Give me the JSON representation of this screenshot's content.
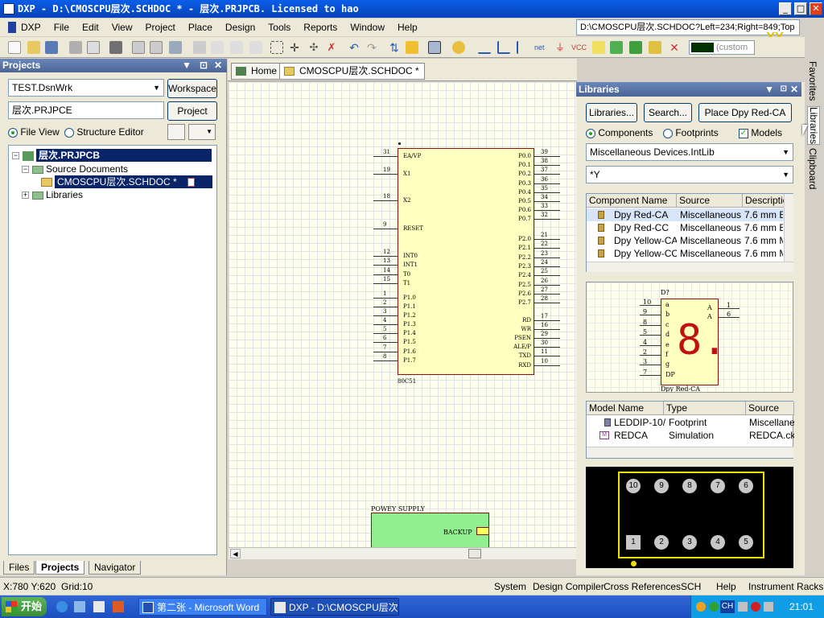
{
  "title_bar": {
    "title": "DXP - D:\\CMOSCPU层次.SCHDOC * - 层次.PRJPCB. Licensed to hao",
    "minimize": "_",
    "maximize": "□",
    "close": "✕"
  },
  "menu": {
    "items": [
      "DXP",
      "File",
      "Edit",
      "View",
      "Project",
      "Place",
      "Design",
      "Tools",
      "Reports",
      "Window",
      "Help"
    ]
  },
  "path_box": "D:\\CMOSCPU层次.SCHDOC?Left=234;Right=849;Top",
  "custom_field": "(custom",
  "projects_panel": {
    "title": "Projects",
    "workspace_combo": "TEST.DsnWrk",
    "workspace_button": "Workspace",
    "project_combo": "层次.PRJPCE",
    "project_button": "Project",
    "file_view": "File View",
    "structure_editor": "Structure Editor",
    "tree": {
      "project": "层次.PRJPCB",
      "source_documents": "Source Documents",
      "document": "CMOSCPU层次.SCHDOC *",
      "libraries": "Libraries"
    },
    "bottom_tabs": [
      "Files",
      "Projects",
      "Navigator"
    ]
  },
  "doc_tabs": [
    "Home",
    "CMOSCPU层次.SCHDOC *"
  ],
  "schematic": {
    "chip_name": "80C51",
    "left_pins": [
      {
        "num": "31",
        "label": "EA/VP"
      },
      {
        "num": "19",
        "label": "X1"
      },
      {
        "num": "18",
        "label": "X2"
      },
      {
        "num": "9",
        "label": "RESET"
      },
      {
        "num": "12",
        "label": "INT0"
      },
      {
        "num": "13",
        "label": "INT1"
      },
      {
        "num": "14",
        "label": "T0"
      },
      {
        "num": "15",
        "label": "T1"
      },
      {
        "num": "1",
        "label": "P1.0"
      },
      {
        "num": "2",
        "label": "P1.1"
      },
      {
        "num": "3",
        "label": "P1.2"
      },
      {
        "num": "4",
        "label": "P1.3"
      },
      {
        "num": "5",
        "label": "P1.4"
      },
      {
        "num": "6",
        "label": "P1.5"
      },
      {
        "num": "7",
        "label": "P1.6"
      },
      {
        "num": "8",
        "label": "P1.7"
      }
    ],
    "right_pins": [
      {
        "num": "39",
        "label": "P0.0"
      },
      {
        "num": "38",
        "label": "P0.1"
      },
      {
        "num": "37",
        "label": "P0.2"
      },
      {
        "num": "36",
        "label": "P0.3"
      },
      {
        "num": "35",
        "label": "P0.4"
      },
      {
        "num": "34",
        "label": "P0.5"
      },
      {
        "num": "33",
        "label": "P0.6"
      },
      {
        "num": "32",
        "label": "P0.7"
      },
      {
        "num": "21",
        "label": "P2.0"
      },
      {
        "num": "22",
        "label": "P2.1"
      },
      {
        "num": "23",
        "label": "P2.2"
      },
      {
        "num": "24",
        "label": "P2.3"
      },
      {
        "num": "25",
        "label": "P2.4"
      },
      {
        "num": "26",
        "label": "P2.5"
      },
      {
        "num": "27",
        "label": "P2.6"
      },
      {
        "num": "28",
        "label": "P2.7"
      },
      {
        "num": "17",
        "label": "RD"
      },
      {
        "num": "16",
        "label": "WR"
      },
      {
        "num": "29",
        "label": "PSEN"
      },
      {
        "num": "30",
        "label": "ALE/P"
      },
      {
        "num": "11",
        "label": "TXD"
      },
      {
        "num": "10",
        "label": "RXD"
      }
    ],
    "power_block": "POWEY SUPPLY",
    "power_port": "BACKUP"
  },
  "libraries_panel": {
    "title": "Libraries",
    "buttons": [
      "Libraries...",
      "Search...",
      "Place Dpy Red-CA"
    ],
    "components_radio": "Components",
    "footprints_radio": "Footprints",
    "models_check": "Models",
    "library_combo": "Miscellaneous Devices.IntLib",
    "filter_combo": "*Y",
    "comp_headers": [
      "Component Name",
      "Source",
      "Descriptio"
    ],
    "components": [
      {
        "name": "Dpy Red-CA",
        "source": "Miscellaneous D",
        "desc": "7.6 mm Bl"
      },
      {
        "name": "Dpy Red-CC",
        "source": "Miscellaneous D",
        "desc": "7.6 mm Bl"
      },
      {
        "name": "Dpy Yellow-CA",
        "source": "Miscellaneous D",
        "desc": "7.6 mm M"
      },
      {
        "name": "Dpy Yellow-CC",
        "source": "Miscellaneous D",
        "desc": "7.6 mm M"
      }
    ],
    "preview": {
      "designator": "D?",
      "name": "Dpy Red-CA",
      "left_nums": [
        "10",
        "9",
        "8",
        "5",
        "4",
        "2",
        "3",
        "7"
      ],
      "left_labels": [
        "a",
        "b",
        "c",
        "d",
        "e",
        "f",
        "g",
        "DP"
      ],
      "right_nums": [
        "1",
        "6"
      ],
      "right_labels": [
        "A",
        "A"
      ],
      "digit": "8."
    },
    "model_headers": [
      "Model Name",
      "Type",
      "Source"
    ],
    "models": [
      {
        "name": "LEDDIP-10/C",
        "type": "Footprint",
        "source": "Miscellaneo"
      },
      {
        "name": "REDCA",
        "type": "Simulation",
        "source": "REDCA.ckt"
      }
    ],
    "footprint_pads_top": [
      "10",
      "9",
      "8",
      "7",
      "6"
    ],
    "footprint_pads_bottom": [
      "1",
      "2",
      "3",
      "4",
      "5"
    ]
  },
  "side_tabs": [
    "Favorites",
    "Libraries",
    "Clipboard"
  ],
  "status_bar": {
    "coords": "X:780 Y:620",
    "grid": "Grid:10",
    "items": [
      "System",
      "Design Compiler",
      "Cross References",
      "SCH",
      "Help",
      "Instrument Racks"
    ]
  },
  "taskbar": {
    "start": "开始",
    "tasks": [
      "第二张 - Microsoft Word",
      "DXP - D:\\CMOSCPU层次...."
    ],
    "clock": "21:01",
    "ime": "CH"
  },
  "colors": {
    "title_blue": "#0542b8",
    "chip_fill": "#ffffc0",
    "power_fill": "#90f090",
    "selection": "#0a246a"
  }
}
